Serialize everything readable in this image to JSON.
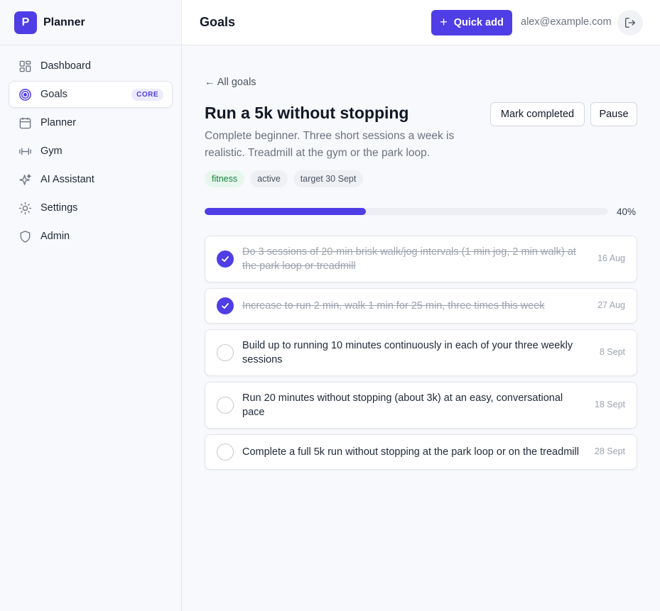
{
  "brand": {
    "logo_letter": "P",
    "name": "Planner"
  },
  "sidebar": {
    "items": [
      {
        "label": "Dashboard",
        "icon": "dashboard-icon"
      },
      {
        "label": "Goals",
        "icon": "target-icon",
        "badge": "CORE",
        "active": true
      },
      {
        "label": "Planner",
        "icon": "calendar-icon"
      },
      {
        "label": "Gym",
        "icon": "dumbbell-icon"
      },
      {
        "label": "AI Assistant",
        "icon": "sparkles-icon"
      },
      {
        "label": "Settings",
        "icon": "sun-icon"
      },
      {
        "label": "Admin",
        "icon": "shield-icon"
      }
    ]
  },
  "header": {
    "title": "Goals",
    "quick_add_label": "Quick add",
    "user_email": "alex@example.com",
    "logout_icon": "logout-icon"
  },
  "goal": {
    "back_label": "← All goals",
    "title": "Run a 5k without stopping",
    "description": "Complete beginner. Three short sessions a week is realistic. Treadmill at the gym or the park loop.",
    "actions": {
      "complete_label": "Mark completed",
      "pause_label": "Pause"
    },
    "tags": [
      "fitness",
      "active",
      "target 30 Sept"
    ],
    "progress": {
      "percent": 40,
      "label": "40%"
    },
    "tasks": [
      {
        "text": "Do 3 sessions of 20-min brisk walk/jog intervals (1 min jog, 2 min walk) at the park loop or treadmill",
        "date": "16 Aug",
        "done": true
      },
      {
        "text": "Increase to run 2 min, walk 1 min for 25 min, three times this week",
        "date": "27 Aug",
        "done": true
      },
      {
        "text": "Build up to running 10 minutes continuously in each of your three weekly sessions",
        "date": "8 Sept",
        "done": false
      },
      {
        "text": "Run 20 minutes without stopping (about 3k) at an easy, conversational pace",
        "date": "18 Sept",
        "done": false
      },
      {
        "text": "Complete a full 5k run without stopping at the park loop or on the treadmill",
        "date": "28 Sept",
        "done": false
      }
    ]
  },
  "colors": {
    "accent": "#4f3de6",
    "tag_green": "#15803d",
    "muted": "#9ca3af"
  }
}
